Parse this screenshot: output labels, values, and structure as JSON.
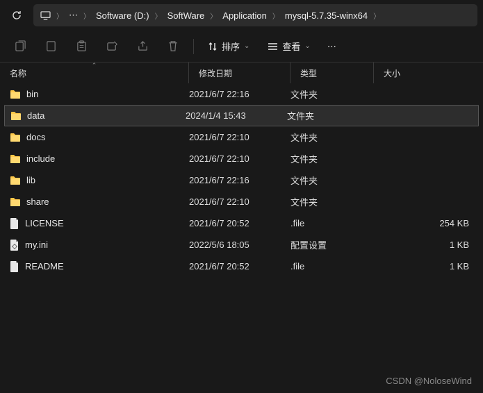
{
  "breadcrumb": {
    "items": [
      "Software (D:)",
      "SoftWare",
      "Application",
      "mysql-5.7.35-winx64"
    ]
  },
  "toolbar": {
    "sort_label": "排序",
    "view_label": "查看"
  },
  "columns": {
    "name": "名称",
    "date": "修改日期",
    "type": "类型",
    "size": "大小"
  },
  "rows": [
    {
      "icon": "folder",
      "name": "bin",
      "date": "2021/6/7 22:16",
      "type": "文件夹",
      "size": "",
      "selected": false
    },
    {
      "icon": "folder",
      "name": "data",
      "date": "2024/1/4 15:43",
      "type": "文件夹",
      "size": "",
      "selected": true
    },
    {
      "icon": "folder",
      "name": "docs",
      "date": "2021/6/7 22:10",
      "type": "文件夹",
      "size": "",
      "selected": false
    },
    {
      "icon": "folder",
      "name": "include",
      "date": "2021/6/7 22:10",
      "type": "文件夹",
      "size": "",
      "selected": false
    },
    {
      "icon": "folder",
      "name": "lib",
      "date": "2021/6/7 22:16",
      "type": "文件夹",
      "size": "",
      "selected": false
    },
    {
      "icon": "folder",
      "name": "share",
      "date": "2021/6/7 22:10",
      "type": "文件夹",
      "size": "",
      "selected": false
    },
    {
      "icon": "file",
      "name": "LICENSE",
      "date": "2021/6/7 20:52",
      "type": ".file",
      "size": "254 KB",
      "selected": false
    },
    {
      "icon": "ini",
      "name": "my.ini",
      "date": "2022/5/6 18:05",
      "type": "配置设置",
      "size": "1 KB",
      "selected": false
    },
    {
      "icon": "file",
      "name": "README",
      "date": "2021/6/7 20:52",
      "type": ".file",
      "size": "1 KB",
      "selected": false
    }
  ],
  "watermark": "CSDN @NoloseWind"
}
